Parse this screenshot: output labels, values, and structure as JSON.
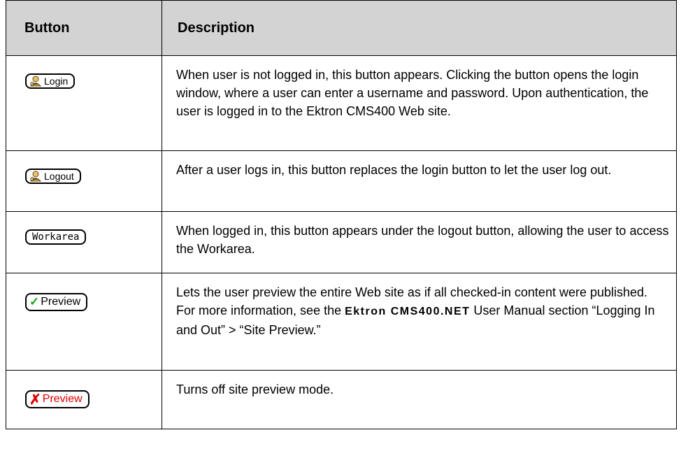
{
  "table": {
    "headers": {
      "button": "Button",
      "description": "Description"
    },
    "rows": [
      {
        "button_label": "Login",
        "button_icon": "user-key-icon",
        "description": "When user is not logged in, this button appears. Clicking the button opens the login window, where a user can enter a username and password. Upon authentication, the user is logged in to the Ektron CMS400 Web site."
      },
      {
        "button_label": "Logout",
        "button_icon": "user-key-icon",
        "description": "After a user logs in, this button replaces the login button to let the user log out."
      },
      {
        "button_label": "Workarea",
        "description": "When logged in, this button appears under the logout button, allowing the user to access the Workarea."
      },
      {
        "button_label": "Preview",
        "button_icon": "green-check-icon",
        "button_icon_color": "#19a31c",
        "description_before": "Lets the user preview the entire Web site as if all checked-in content were published. For more information, see the ",
        "description_emphasis": "Ektron CMS400.NET",
        "description_after": " User Manual section “Logging In and Out” > “Site Preview.”"
      },
      {
        "button_label": "Preview",
        "button_icon": "red-x-icon",
        "button_color": "#e00000",
        "description": "Turns off site preview mode."
      }
    ]
  }
}
